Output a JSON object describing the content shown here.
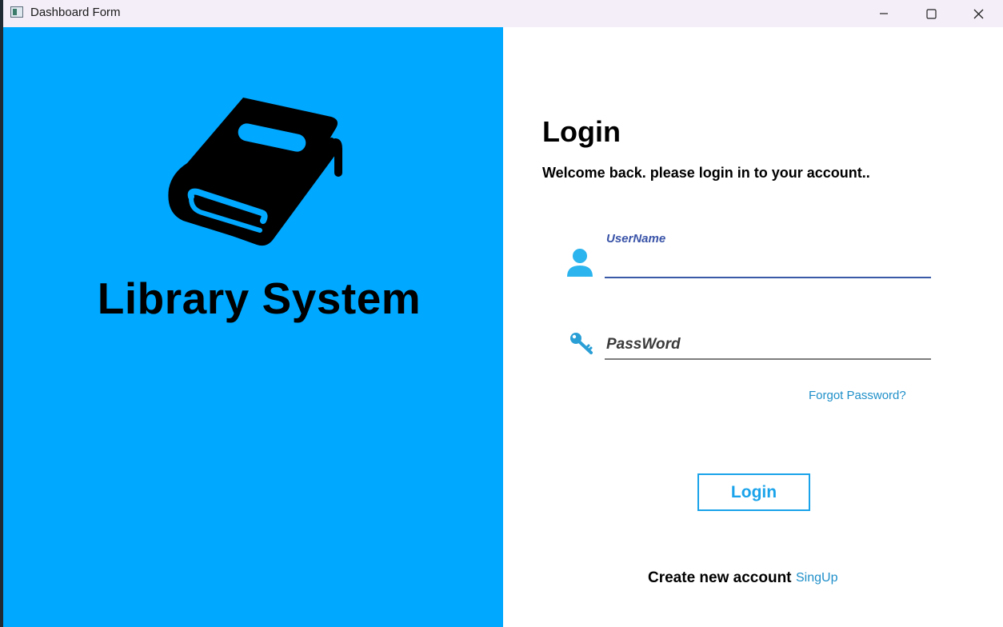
{
  "window": {
    "title": "Dashboard Form",
    "controls": {
      "minimize": "minimize-icon",
      "maximize": "maximize-icon",
      "close": "close-icon"
    }
  },
  "branding": {
    "icon": "book-icon",
    "title": "Library System",
    "background_color": "#00a8ff"
  },
  "login_form": {
    "heading": "Login",
    "subtitle": "Welcome back. please login in to your account..",
    "username": {
      "label": "UserName",
      "value": "",
      "icon": "user-icon"
    },
    "password": {
      "placeholder": "PassWord",
      "value": "",
      "icon": "key-icon"
    },
    "forgot_password": "Forgot Password?",
    "submit_label": "Login",
    "accent_color": "#1aa3ea"
  },
  "footer": {
    "prompt": "Create new account",
    "signup_link": "SingUp"
  }
}
